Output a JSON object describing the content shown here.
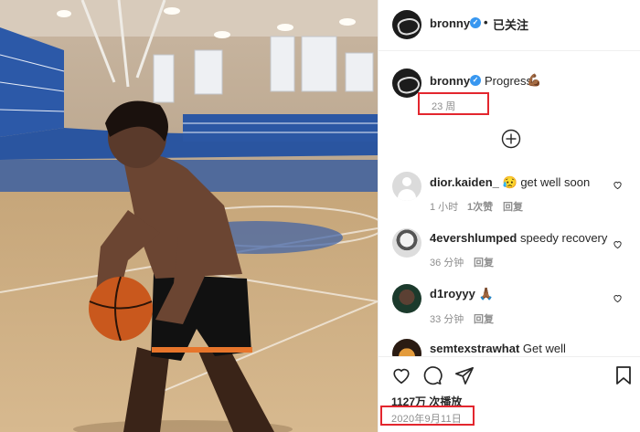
{
  "header": {
    "username": "bronny",
    "follow_status": "已关注",
    "separator": "•"
  },
  "post": {
    "caption_user": "bronny",
    "caption_text": "Progress",
    "caption_emoji": "💪🏾",
    "time_ago": "23 周"
  },
  "comments": [
    {
      "user": "dior.kaiden_",
      "emoji": "😥",
      "text": "get well soon",
      "time": "1 小时",
      "likes": "1次赞",
      "reply": "回复"
    },
    {
      "user": "4evershlumped",
      "text": "speedy recovery",
      "time": "36 分钟",
      "reply": "回复"
    },
    {
      "user": "d1royyy",
      "emoji": "🙏🏾",
      "text": "",
      "time": "33 分钟",
      "reply": "回复"
    },
    {
      "user": "semtexstrawhat",
      "text": "Get well",
      "time": "",
      "reply": ""
    }
  ],
  "footer": {
    "views": "1127万 次播放",
    "date": "2020年9月11日"
  },
  "colors": {
    "highlight": "#e3262e",
    "verified": "#3897f0"
  }
}
